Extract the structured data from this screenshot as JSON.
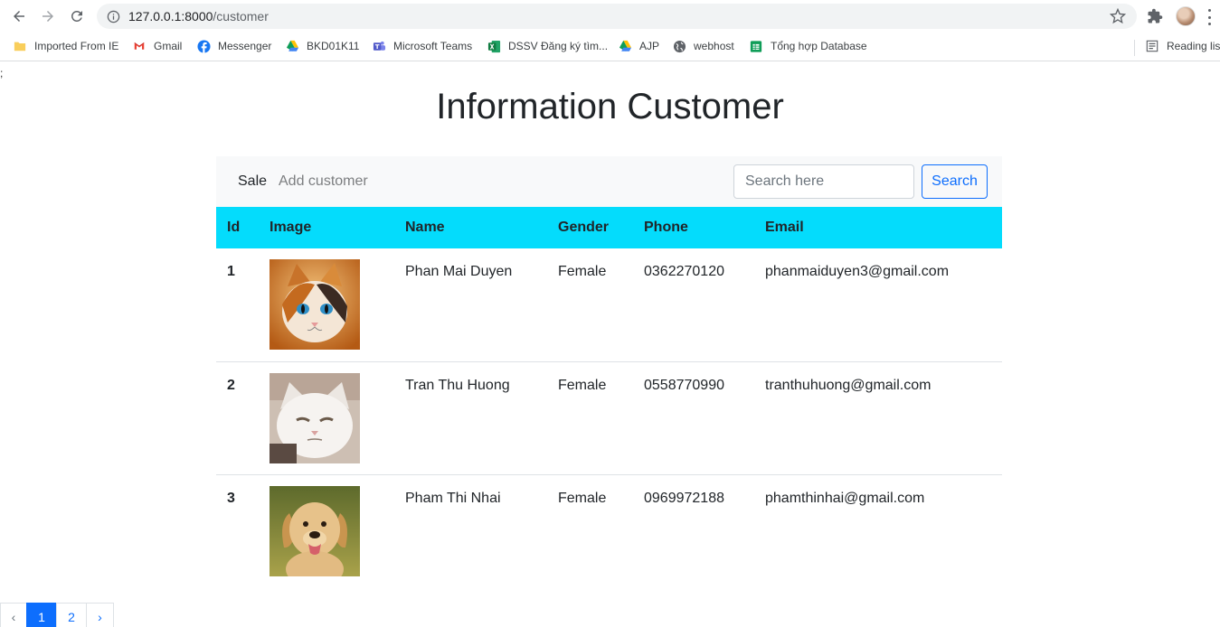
{
  "browser": {
    "url_host": "127.0.0.1:8000",
    "url_path": "/customer",
    "bookmarks": [
      {
        "label": "Imported From IE",
        "icon": "folder-icon"
      },
      {
        "label": "Gmail",
        "icon": "gmail-icon"
      },
      {
        "label": "Messenger",
        "icon": "facebook-icon"
      },
      {
        "label": "BKD01K11",
        "icon": "google-drive-icon"
      },
      {
        "label": "Microsoft Teams",
        "icon": "teams-icon"
      },
      {
        "label": "DSSV Đăng ký tìm...",
        "icon": "excel-icon"
      },
      {
        "label": "AJP",
        "icon": "google-drive-icon"
      },
      {
        "label": "webhost",
        "icon": "globe-icon"
      },
      {
        "label": "Tổng hợp Database",
        "icon": "google-sheets-icon"
      }
    ],
    "reading_list": "Reading list"
  },
  "page": {
    "stray_char": ";",
    "title": "Information Customer"
  },
  "navbar": {
    "brand": "Sale",
    "link": "Add customer",
    "search_placeholder": "Search here",
    "search_button": "Search"
  },
  "table": {
    "headers": {
      "id": "Id",
      "image": "Image",
      "name": "Name",
      "gender": "Gender",
      "phone": "Phone",
      "email": "Email"
    },
    "rows": [
      {
        "id": "1",
        "image": "calico-cat-photo",
        "name": "Phan Mai Duyen",
        "gender": "Female",
        "phone": "0362270120",
        "email": "phanmaiduyen3@gmail.com"
      },
      {
        "id": "2",
        "image": "white-cat-photo",
        "name": "Tran Thu Huong",
        "gender": "Female",
        "phone": "0558770990",
        "email": "tranthuhuong@gmail.com"
      },
      {
        "id": "3",
        "image": "labrador-dog-photo",
        "name": "Pham Thi Nhai",
        "gender": "Female",
        "phone": "0969972188",
        "email": "phamthinhai@gmail.com"
      }
    ]
  },
  "pagination": {
    "prev": "‹",
    "pages": [
      "1",
      "2"
    ],
    "active": "1",
    "next": "›"
  },
  "colors": {
    "table_header": "#04dcfc",
    "primary": "#0d6efd",
    "navbar_bg": "#f8f9fa"
  }
}
